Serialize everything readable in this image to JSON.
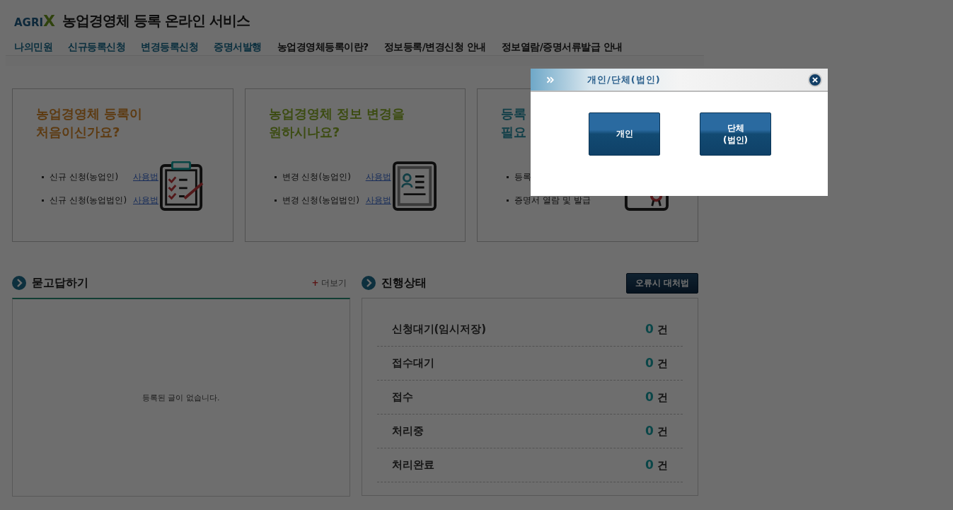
{
  "header": {
    "logo": "AGRI",
    "logo_mark": "X",
    "title": "농업경영체 등록 온라인 서비스"
  },
  "nav": [
    {
      "label": "나의민원",
      "highlighted": true
    },
    {
      "label": "신규등록신청",
      "highlighted": true
    },
    {
      "label": "변경등록신청",
      "highlighted": true
    },
    {
      "label": "증명서발행",
      "highlighted": true
    },
    {
      "label": "농업경영체등록이란?",
      "highlighted": false
    },
    {
      "label": "정보등록/변경신청 안내",
      "highlighted": false
    },
    {
      "label": "정보열람/증명서류발급 안내",
      "highlighted": false
    }
  ],
  "cards": [
    {
      "title": [
        "농업경영체 등록이",
        "처음이신가요?"
      ],
      "items": [
        {
          "text": "신규 신청(농업인)",
          "link": "사용법"
        },
        {
          "text": "신규 신청(농업법인)",
          "link": "사용법"
        }
      ]
    },
    {
      "title": [
        "농업경영체 정보 변경을",
        "원하시나요?"
      ],
      "items": [
        {
          "text": "변경 신청(농업인)",
          "link": "사용법"
        },
        {
          "text": "변경 신청(농업법인)",
          "link": "사용법"
        }
      ]
    },
    {
      "title": [
        "등록",
        "필요"
      ],
      "items": [
        {
          "text": "등록"
        },
        {
          "text": "증명서 열람 및 발급"
        }
      ]
    }
  ],
  "qna": {
    "title": "묻고답하기",
    "more_mark": "+",
    "more": "더보기",
    "empty": "등록된 글이 없습니다."
  },
  "status": {
    "title": "진행상태",
    "help_button": "오류시 대처법",
    "rows": [
      {
        "label": "신청대기(임시저장)",
        "count": "0",
        "unit": "건"
      },
      {
        "label": "접수대기",
        "count": "0",
        "unit": "건"
      },
      {
        "label": "접수",
        "count": "0",
        "unit": "건"
      },
      {
        "label": "처리중",
        "count": "0",
        "unit": "건"
      },
      {
        "label": "처리완료",
        "count": "0",
        "unit": "건"
      }
    ]
  },
  "modal": {
    "title": "개인/단체(법인)",
    "buttons": [
      [
        "개인"
      ],
      [
        "단체",
        "(법인)"
      ]
    ]
  }
}
